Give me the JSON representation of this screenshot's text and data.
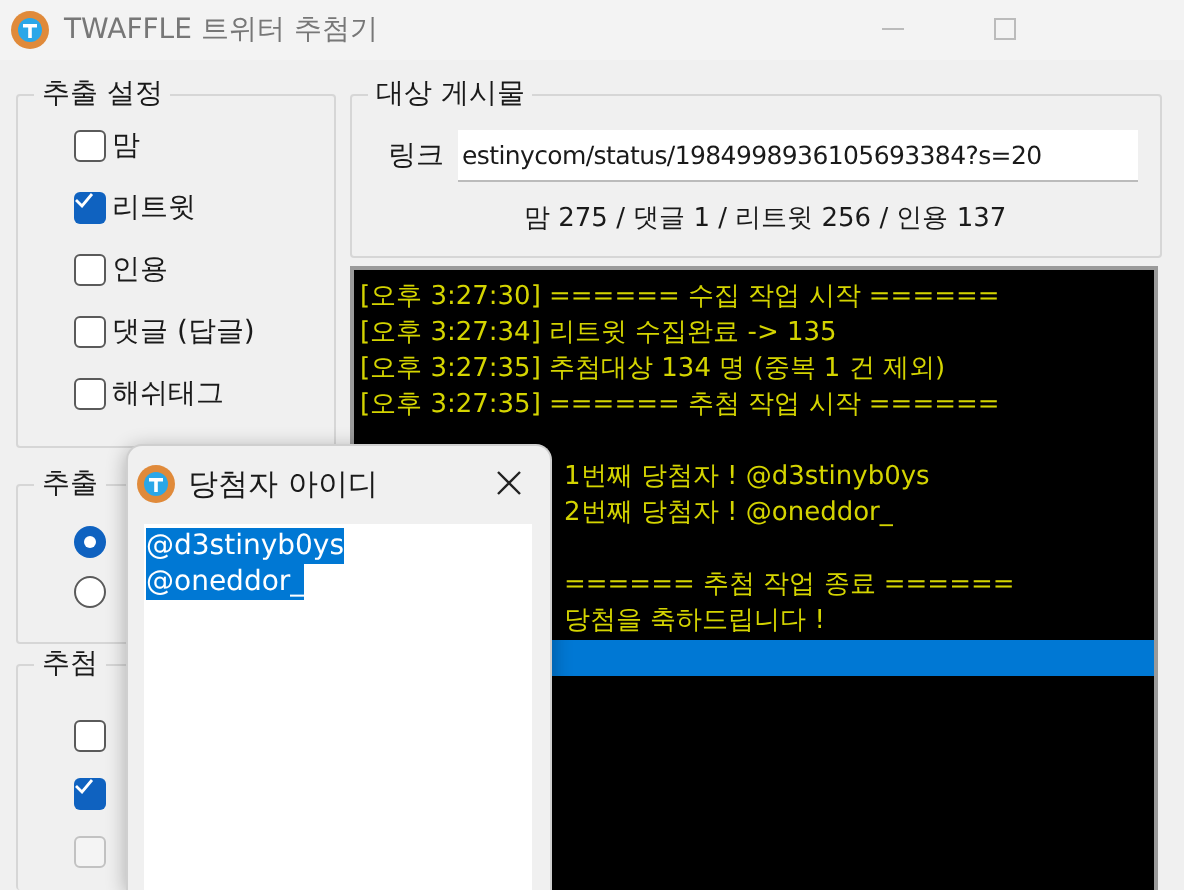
{
  "window": {
    "title": "TWAFFLE 트위터 추첨기"
  },
  "extract_settings": {
    "title": "추출 설정",
    "options": [
      {
        "label": "맘",
        "checked": false
      },
      {
        "label": "리트윗",
        "checked": true
      },
      {
        "label": "인용",
        "checked": false
      },
      {
        "label": "댓글 (답글)",
        "checked": false
      },
      {
        "label": "해쉬태그",
        "checked": false
      }
    ]
  },
  "group_2": {
    "title": "추출",
    "radios": [
      {
        "selected": true
      },
      {
        "selected": false
      }
    ]
  },
  "group_3": {
    "title": "추첨",
    "checks": [
      {
        "checked": false,
        "disabled": false
      },
      {
        "checked": true,
        "disabled": false
      },
      {
        "checked": false,
        "disabled": true
      }
    ]
  },
  "target_post": {
    "title": "대상 게시물",
    "link_label": "링크",
    "link_value": "estinycom/status/1984998936105693384?s=20",
    "stats": "맘 275 / 댓글 1 / 리트윗 256 / 인용 137"
  },
  "log": {
    "lines": [
      {
        "text": "[오후 3:27:30] ====== 수집 작업 시작 ======",
        "selected": false
      },
      {
        "text": "[오후 3:27:34] 리트윗 수집완료 -> 135",
        "selected": false
      },
      {
        "text": "[오후 3:27:35] 추첨대상 134 명 (중복 1 건 제외)",
        "selected": false
      },
      {
        "text": "[오후 3:27:35] ====== 추첨 작업 시작 ======",
        "selected": false
      },
      {
        "selected": false
      },
      {
        "text": "1번째 당첨자 ! @d3stinyb0ys",
        "selected": false
      },
      {
        "text": "2번째 당첨자 ! @oneddor_",
        "selected": false
      },
      {
        "selected": false
      },
      {
        "text": "====== 추첨 작업 종료 ======",
        "selected": false
      },
      {
        "text": "당첨을 축하드립니다 !",
        "selected": false
      },
      {
        "selected": true
      }
    ]
  },
  "winners_dialog": {
    "title": "당첨자 아이디",
    "winners": [
      "@d3stinyb0ys",
      "@oneddor_"
    ]
  }
}
